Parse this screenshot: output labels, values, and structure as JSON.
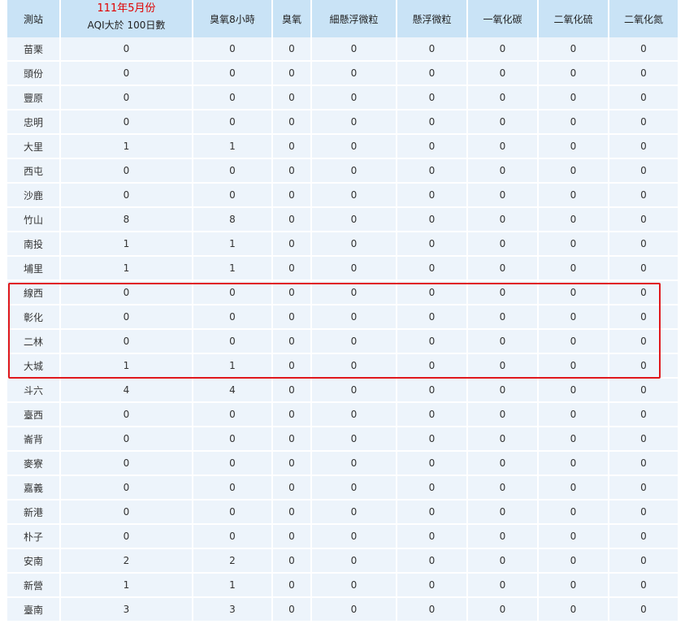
{
  "headers": {
    "station": "測站",
    "month_note": "111年5月份",
    "aqi": "AQI大於 100日數",
    "o3_8hr": "臭氧8小時",
    "o3": "臭氧",
    "pm25": "細懸浮微粒",
    "pm10": "懸浮微粒",
    "co": "一氧化碳",
    "so2": "二氧化硫",
    "no2": "二氧化氮"
  },
  "rows": [
    {
      "station": "苗栗",
      "aqi": "0",
      "o3_8hr": "0",
      "o3": "0",
      "pm25": "0",
      "pm10": "0",
      "co": "0",
      "so2": "0",
      "no2": "0"
    },
    {
      "station": "頭份",
      "aqi": "0",
      "o3_8hr": "0",
      "o3": "0",
      "pm25": "0",
      "pm10": "0",
      "co": "0",
      "so2": "0",
      "no2": "0"
    },
    {
      "station": "豐原",
      "aqi": "0",
      "o3_8hr": "0",
      "o3": "0",
      "pm25": "0",
      "pm10": "0",
      "co": "0",
      "so2": "0",
      "no2": "0"
    },
    {
      "station": "忠明",
      "aqi": "0",
      "o3_8hr": "0",
      "o3": "0",
      "pm25": "0",
      "pm10": "0",
      "co": "0",
      "so2": "0",
      "no2": "0"
    },
    {
      "station": "大里",
      "aqi": "1",
      "o3_8hr": "1",
      "o3": "0",
      "pm25": "0",
      "pm10": "0",
      "co": "0",
      "so2": "0",
      "no2": "0"
    },
    {
      "station": "西屯",
      "aqi": "0",
      "o3_8hr": "0",
      "o3": "0",
      "pm25": "0",
      "pm10": "0",
      "co": "0",
      "so2": "0",
      "no2": "0"
    },
    {
      "station": "沙鹿",
      "aqi": "0",
      "o3_8hr": "0",
      "o3": "0",
      "pm25": "0",
      "pm10": "0",
      "co": "0",
      "so2": "0",
      "no2": "0"
    },
    {
      "station": "竹山",
      "aqi": "8",
      "o3_8hr": "8",
      "o3": "0",
      "pm25": "0",
      "pm10": "0",
      "co": "0",
      "so2": "0",
      "no2": "0"
    },
    {
      "station": "南投",
      "aqi": "1",
      "o3_8hr": "1",
      "o3": "0",
      "pm25": "0",
      "pm10": "0",
      "co": "0",
      "so2": "0",
      "no2": "0"
    },
    {
      "station": "埔里",
      "aqi": "1",
      "o3_8hr": "1",
      "o3": "0",
      "pm25": "0",
      "pm10": "0",
      "co": "0",
      "so2": "0",
      "no2": "0"
    },
    {
      "station": "線西",
      "aqi": "0",
      "o3_8hr": "0",
      "o3": "0",
      "pm25": "0",
      "pm10": "0",
      "co": "0",
      "so2": "0",
      "no2": "0"
    },
    {
      "station": "彰化",
      "aqi": "0",
      "o3_8hr": "0",
      "o3": "0",
      "pm25": "0",
      "pm10": "0",
      "co": "0",
      "so2": "0",
      "no2": "0"
    },
    {
      "station": "二林",
      "aqi": "0",
      "o3_8hr": "0",
      "o3": "0",
      "pm25": "0",
      "pm10": "0",
      "co": "0",
      "so2": "0",
      "no2": "0"
    },
    {
      "station": "大城",
      "aqi": "1",
      "o3_8hr": "1",
      "o3": "0",
      "pm25": "0",
      "pm10": "0",
      "co": "0",
      "so2": "0",
      "no2": "0"
    },
    {
      "station": "斗六",
      "aqi": "4",
      "o3_8hr": "4",
      "o3": "0",
      "pm25": "0",
      "pm10": "0",
      "co": "0",
      "so2": "0",
      "no2": "0"
    },
    {
      "station": "臺西",
      "aqi": "0",
      "o3_8hr": "0",
      "o3": "0",
      "pm25": "0",
      "pm10": "0",
      "co": "0",
      "so2": "0",
      "no2": "0"
    },
    {
      "station": "崙背",
      "aqi": "0",
      "o3_8hr": "0",
      "o3": "0",
      "pm25": "0",
      "pm10": "0",
      "co": "0",
      "so2": "0",
      "no2": "0"
    },
    {
      "station": "麥寮",
      "aqi": "0",
      "o3_8hr": "0",
      "o3": "0",
      "pm25": "0",
      "pm10": "0",
      "co": "0",
      "so2": "0",
      "no2": "0"
    },
    {
      "station": "嘉義",
      "aqi": "0",
      "o3_8hr": "0",
      "o3": "0",
      "pm25": "0",
      "pm10": "0",
      "co": "0",
      "so2": "0",
      "no2": "0"
    },
    {
      "station": "新港",
      "aqi": "0",
      "o3_8hr": "0",
      "o3": "0",
      "pm25": "0",
      "pm10": "0",
      "co": "0",
      "so2": "0",
      "no2": "0"
    },
    {
      "station": "朴子",
      "aqi": "0",
      "o3_8hr": "0",
      "o3": "0",
      "pm25": "0",
      "pm10": "0",
      "co": "0",
      "so2": "0",
      "no2": "0"
    },
    {
      "station": "安南",
      "aqi": "2",
      "o3_8hr": "2",
      "o3": "0",
      "pm25": "0",
      "pm10": "0",
      "co": "0",
      "so2": "0",
      "no2": "0"
    },
    {
      "station": "新營",
      "aqi": "1",
      "o3_8hr": "1",
      "o3": "0",
      "pm25": "0",
      "pm10": "0",
      "co": "0",
      "so2": "0",
      "no2": "0"
    },
    {
      "station": "臺南",
      "aqi": "3",
      "o3_8hr": "3",
      "o3": "0",
      "pm25": "0",
      "pm10": "0",
      "co": "0",
      "so2": "0",
      "no2": "0"
    }
  ],
  "colors": {
    "header_bg": "#c9e3f6",
    "row_bg": "#edf4fb",
    "highlight_border": "#e0181c",
    "month_note": "#e00000"
  }
}
